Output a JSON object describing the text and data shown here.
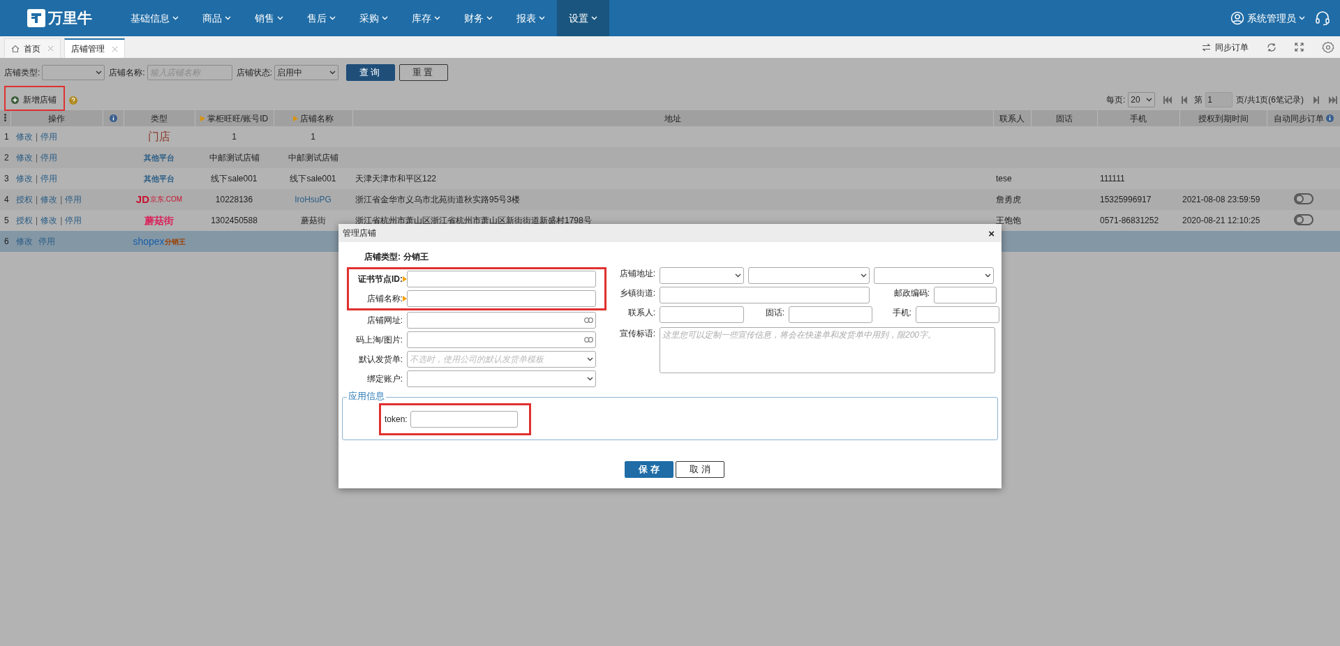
{
  "nav": {
    "brand": "万里牛",
    "menu": [
      {
        "label": "基础信息",
        "selected": false
      },
      {
        "label": "商品",
        "selected": false
      },
      {
        "label": "销售",
        "selected": false
      },
      {
        "label": "售后",
        "selected": false
      },
      {
        "label": "采购",
        "selected": false
      },
      {
        "label": "库存",
        "selected": false
      },
      {
        "label": "财务",
        "selected": false
      },
      {
        "label": "报表",
        "selected": false
      },
      {
        "label": "设置",
        "selected": true
      }
    ],
    "user": "系统管理员"
  },
  "tabs": [
    {
      "label": "首页",
      "kind": "home",
      "selected": false
    },
    {
      "label": "店铺管理",
      "kind": "page",
      "selected": true
    }
  ],
  "sync_button": "同步订单",
  "filters": [
    {
      "kind": "select",
      "label": "店铺类型:"
    },
    {
      "kind": "input",
      "label": "店铺名称:",
      "placeholder": "输入店铺名称"
    },
    {
      "kind": "select",
      "label": "店铺状态:",
      "value": "启用中"
    }
  ],
  "filter_buttons": [
    {
      "label": "查询",
      "kind": "primary"
    },
    {
      "label": "重置",
      "kind": "plain"
    }
  ],
  "add_button": "新增店铺",
  "pagination": {
    "per_page_label": "每页:",
    "per_page": "20",
    "page_prefix": "第",
    "page": "1",
    "page_suffix": "页/共1页(6笔记录)"
  },
  "table": {
    "action_separator": "|",
    "columns": [
      {
        "label": "操作",
        "sortable": false
      },
      {
        "label": "类型",
        "sortable": false
      },
      {
        "label": "掌柜旺旺/账号ID",
        "sortable": true
      },
      {
        "label": "店铺名称",
        "sortable": true
      },
      {
        "label": "地址",
        "sortable": false
      },
      {
        "label": "联系人",
        "sortable": false
      },
      {
        "label": "固话",
        "sortable": false
      },
      {
        "label": "手机",
        "sortable": false
      },
      {
        "label": "授权到期时间",
        "sortable": false
      },
      {
        "label": "自动同步订单",
        "sortable": false
      }
    ],
    "rows": [
      {
        "index": "1",
        "selected": false,
        "actions": [
          "修改",
          "停用"
        ],
        "type": {
          "kind": "store",
          "text": "门店"
        },
        "account_id": "1",
        "store_name": "1",
        "store_name_link": false
      },
      {
        "index": "2",
        "selected": false,
        "actions": [
          "修改",
          "停用"
        ],
        "type": {
          "kind": "other",
          "text": "其他平台"
        },
        "account_id": "中邮测试店铺",
        "store_name": "中邮测试店铺",
        "store_name_link": false
      },
      {
        "index": "3",
        "selected": false,
        "actions": [
          "修改",
          "停用"
        ],
        "type": {
          "kind": "other",
          "text": "其他平台"
        },
        "account_id": "线下sale001",
        "store_name": "线下sale001",
        "store_name_link": false,
        "address": "天津天津市和平区122",
        "contact": "tese",
        "mobile": "111111"
      },
      {
        "index": "4",
        "selected": false,
        "actions": [
          "授权",
          "修改",
          "停用"
        ],
        "type": {
          "kind": "jd",
          "text": "JD",
          "sub": "京东.COM"
        },
        "account_id": "10228136",
        "store_name": "IroHsuPG",
        "store_name_link": true,
        "address": "浙江省金华市义乌市北苑街道秋实路95号3楼",
        "contact": "詹勇虎",
        "mobile": "15325996917",
        "auth_expiry": "2021-08-08 23:59:59",
        "auto_sync": false
      },
      {
        "index": "5",
        "selected": false,
        "actions": [
          "授权",
          "修改",
          "停用"
        ],
        "type": {
          "kind": "mogujie",
          "text": "蘑菇街"
        },
        "account_id": "1302450588",
        "store_name": "蘑菇街",
        "store_name_link": false,
        "address": "浙江省杭州市萧山区浙江省杭州市萧山区新街街道新盛村1798号",
        "contact": "王饱饱",
        "mobile": "0571-86831252",
        "auth_expiry": "2020-08-21 12:10:25",
        "auto_sync": false
      },
      {
        "index": "6",
        "selected": true,
        "actions": [
          "修改",
          "停用"
        ],
        "type": {
          "kind": "shopex",
          "text": "shopex",
          "sub": "分销王"
        }
      }
    ]
  },
  "dialog": {
    "title": "管理店铺",
    "close": "×",
    "store_type_label": "店铺类型:",
    "store_type": "分销王",
    "left_fields": [
      {
        "label": "证书节点ID:",
        "kind": "input",
        "required": true,
        "strong": true
      },
      {
        "label": "店铺名称:",
        "kind": "input",
        "required": true,
        "strong": false
      },
      {
        "label": "店铺网址:",
        "kind": "link",
        "required": false,
        "strong": false
      },
      {
        "label": "码上淘/图片:",
        "kind": "link",
        "required": false,
        "strong": false
      },
      {
        "label": "默认发货单:",
        "kind": "select",
        "required": false,
        "strong": false,
        "placeholder": "不选时，使用公司的默认发货单模板"
      },
      {
        "label": "绑定账户:",
        "kind": "select",
        "required": false,
        "strong": false
      }
    ],
    "right_rows": [
      [
        {
          "label": "店铺地址:",
          "kind": "select"
        },
        {
          "kind": "select"
        },
        {
          "kind": "select"
        }
      ],
      [
        {
          "label": "乡镇街道:",
          "kind": "input"
        },
        {
          "label": "邮政编码:",
          "kind": "input"
        }
      ],
      [
        {
          "label": "联系人:",
          "kind": "input"
        },
        {
          "label": "固话:",
          "kind": "input"
        },
        {
          "label": "手机:",
          "kind": "input"
        }
      ],
      [
        {
          "label": "宣传标语:",
          "kind": "textarea",
          "placeholder": "这里您可以定制一些宣传信息，将会在快递单和发货单中用到，限200字。"
        }
      ]
    ],
    "app_info": {
      "legend": "应用信息",
      "token_label": "token:"
    },
    "buttons": [
      {
        "label": "保 存",
        "kind": "primary"
      },
      {
        "label": "取 消",
        "kind": "plain"
      }
    ]
  }
}
